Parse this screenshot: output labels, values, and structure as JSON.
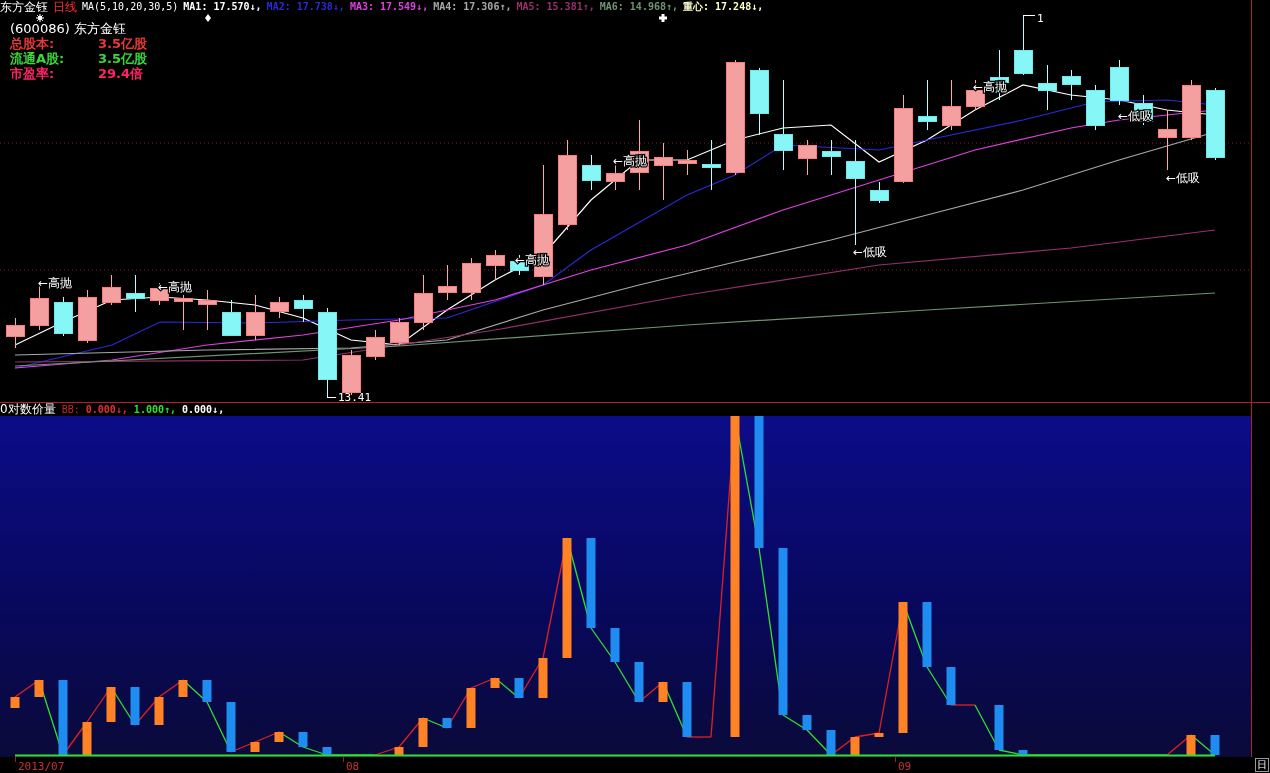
{
  "header": {
    "stock_name": "东方金钰",
    "period": "日线",
    "ma_params": "MA(5,10,20,30,5)",
    "indicators": [
      {
        "text": "MA1: 17.570↓,",
        "color": "#ffffff"
      },
      {
        "text": "MA2: 17.738↓,",
        "color": "#2a2ad8"
      },
      {
        "text": "MA3: 17.549↓,",
        "color": "#e040e0"
      },
      {
        "text": "MA4: 17.306↑,",
        "color": "#a8a8a8"
      },
      {
        "text": "MA5: 15.381↑,",
        "color": "#98306c"
      },
      {
        "text": "MA6: 14.968↑,",
        "color": "#6e9474"
      },
      {
        "text": "重心: 17.248↓,",
        "color": "#ffffd0"
      }
    ]
  },
  "info": {
    "title": "(600086) 东方金钰",
    "rows": [
      {
        "label": "总股本:",
        "value": "3.5亿股",
        "color": "#e83838"
      },
      {
        "label": "流通A股:",
        "value": "3.5亿股",
        "color": "#38d838"
      },
      {
        "label": "市盈率:",
        "value": "29.4倍",
        "color": "#ff2468"
      }
    ]
  },
  "price_chart": {
    "annotations": [
      {
        "text": "←高抛",
        "kind": "signal"
      },
      {
        "text": "←高抛",
        "kind": "signal"
      },
      {
        "text": "13.41",
        "kind": "price"
      },
      {
        "text": "←高抛",
        "kind": "signal"
      },
      {
        "text": "←高抛",
        "kind": "signal"
      },
      {
        "text": "←低吸",
        "kind": "signal"
      },
      {
        "text": "←高抛",
        "kind": "signal"
      },
      {
        "text": "1",
        "kind": "price"
      },
      {
        "text": "←低吸",
        "kind": "signal"
      },
      {
        "text": "←低吸",
        "kind": "signal"
      }
    ]
  },
  "indicator_panel": {
    "title": "0对数价量",
    "label": "BB:",
    "readings": [
      {
        "text": "0.000↓,",
        "color": "#e03030"
      },
      {
        "text": "1.000↑,",
        "color": "#30e030"
      },
      {
        "text": "0.000↓,",
        "color": "#ffffff"
      }
    ]
  },
  "time_axis": {
    "labels": [
      "2013/07",
      "08",
      "09"
    ]
  },
  "period_button": "日"
}
